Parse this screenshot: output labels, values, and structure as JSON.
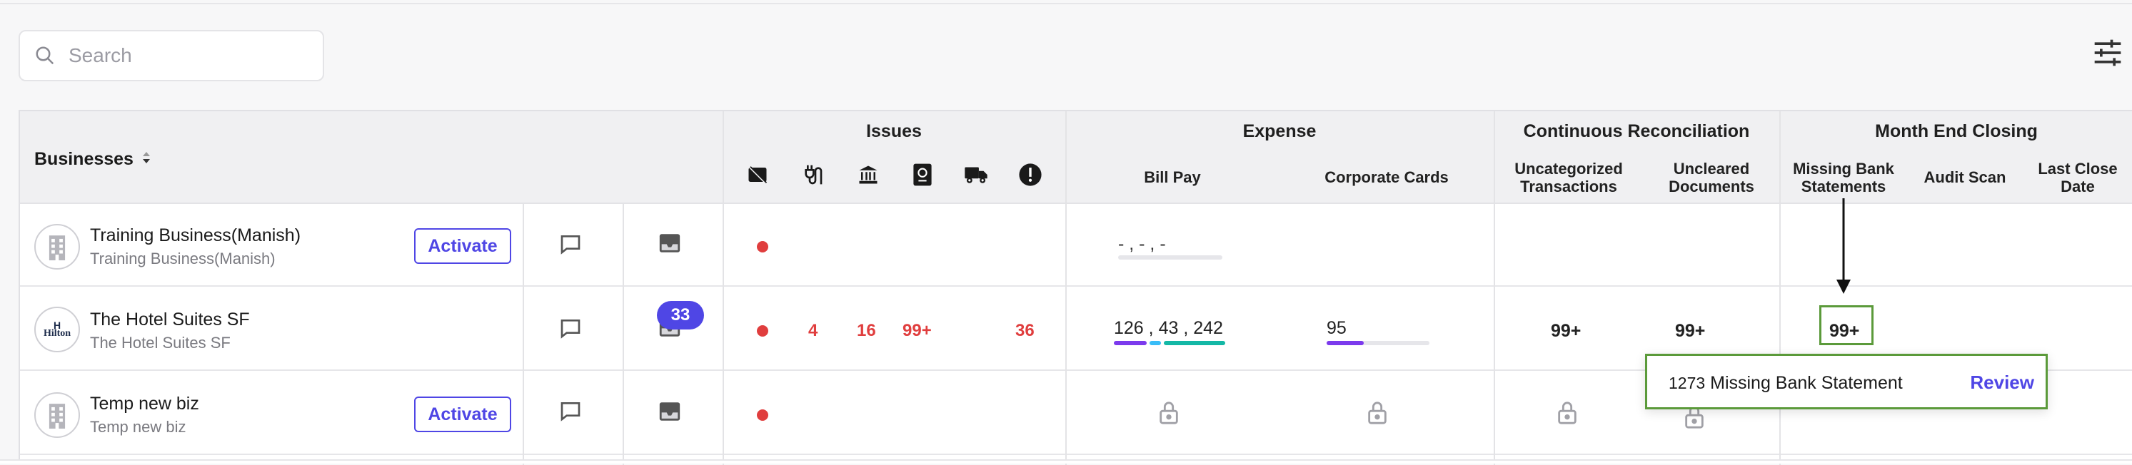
{
  "search": {
    "placeholder": "Search",
    "value": ""
  },
  "columns": {
    "businesses": "Businesses",
    "issues": "Issues",
    "expense": "Expense",
    "bill_pay": "Bill Pay",
    "corporate_cards": "Corporate Cards",
    "continuous_reconciliation": "Continuous Reconciliation",
    "uncategorized_1": "Uncategorized",
    "uncategorized_2": "Transactions",
    "uncleared_1": "Uncleared",
    "uncleared_2": "Documents",
    "month_end_closing": "Month End Closing",
    "missing_bank_1": "Missing Bank",
    "missing_bank_2": "Statements",
    "audit_scan": "Audit Scan",
    "last_close_1": "Last Close",
    "last_close_2": "Date"
  },
  "issue_icons": [
    "no-card-icon",
    "plug-icon",
    "bank-icon",
    "passport-icon",
    "truck-icon",
    "alert-icon"
  ],
  "rows": [
    {
      "name": "Training Business(Manish)",
      "subtitle": "Training Business(Manish)",
      "activate_label": "Activate",
      "bill_pay": "- , - , -"
    },
    {
      "name": "The Hotel Suites SF",
      "subtitle": "The Hotel Suites SF",
      "logo_text": "Hilton",
      "inbox_badge": "33",
      "issues": [
        "4",
        "16",
        "99+",
        "36"
      ],
      "bill_pay": [
        "126",
        "43",
        "242"
      ],
      "bill_pay_sep": ",",
      "corporate_cards": "95",
      "uncategorized": "99+",
      "uncleared": "99+",
      "missing_bank": "99+"
    },
    {
      "name": "Temp new biz",
      "subtitle": "Temp new biz",
      "activate_label": "Activate"
    }
  ],
  "tooltip": {
    "count": "1273",
    "text": "Missing Bank Statement",
    "action": "Review"
  },
  "colors": {
    "accent": "#4f46e5",
    "danger": "#e03e3e",
    "highlight": "#5b9a3a",
    "bar_purple": "#7c3aed",
    "bar_blue": "#38bdf8",
    "bar_teal": "#14b8a6"
  }
}
